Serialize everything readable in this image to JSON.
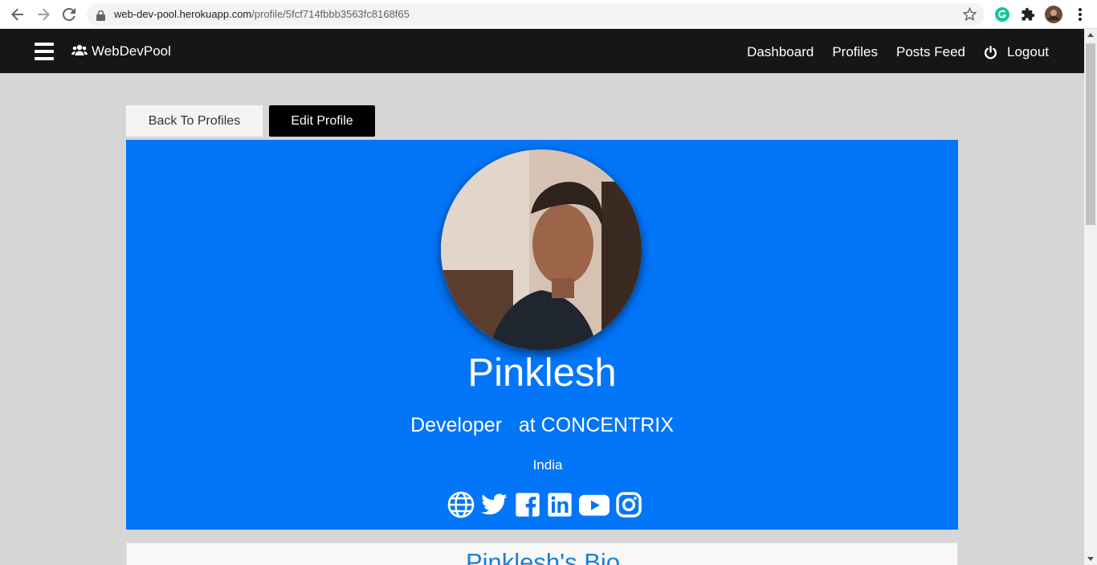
{
  "browser": {
    "url_host": "web-dev-pool.herokuapp.com",
    "url_path": "/profile/5fcf714fbbb3563fc8168f65"
  },
  "navbar": {
    "brand": "WebDevPool",
    "links": [
      "Dashboard",
      "Profiles",
      "Posts Feed",
      "Logout"
    ]
  },
  "actions": {
    "back_label": "Back To Profiles",
    "edit_label": "Edit Profile"
  },
  "profile": {
    "name": "Pinklesh",
    "title": "Developer   at CONCENTRIX",
    "location": "India",
    "social_icons": [
      "globe-icon",
      "twitter-icon",
      "facebook-icon",
      "linkedin-icon",
      "youtube-icon",
      "instagram-icon"
    ]
  },
  "bio": {
    "heading": "Pinklesh's Bio"
  },
  "colors": {
    "profile_bg": "#0275f9",
    "navbar_bg": "#161616",
    "page_bg": "#d6d6d6"
  }
}
